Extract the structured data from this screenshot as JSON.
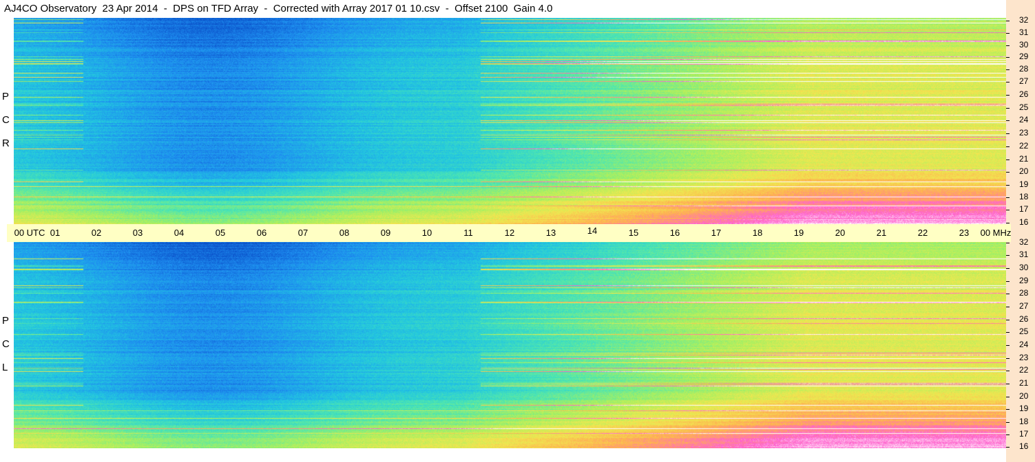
{
  "title": "AJ4CO Observatory  23 Apr 2014  -  DPS on TFD Array  -  Corrected with Array 2017 01 10.csv  -  Offset 2100  Gain 4.0",
  "panels": [
    {
      "id": "rcp",
      "letters": [
        "P",
        "C",
        "R"
      ]
    },
    {
      "id": "lcp",
      "letters": [
        "P",
        "C",
        "L"
      ]
    }
  ],
  "time_axis": {
    "labels": [
      "00  UTC",
      "01",
      "02",
      "03",
      "04",
      "05",
      "06",
      "07",
      "08",
      "09",
      "10",
      "11",
      "12",
      "13",
      "14",
      "15",
      "16",
      "17",
      "18",
      "19",
      "20",
      "21",
      "22",
      "23",
      "00 MHz"
    ]
  },
  "frequency_axis": {
    "unit": "MHz",
    "labels": [
      "32",
      "31",
      "30",
      "29",
      "28",
      "27",
      "26",
      "25",
      "24",
      "23",
      "22",
      "21",
      "20",
      "19",
      "18",
      "17",
      "16"
    ]
  },
  "colors": {
    "axis_bar": "#ffffc4",
    "right_strip": "#fde5cc",
    "colormap": [
      "#0a4fc8",
      "#1e8ef0",
      "#22c7e0",
      "#4ee6b0",
      "#a8f060",
      "#f0e850",
      "#ffb050",
      "#ff60d0",
      "#ffffff"
    ]
  }
}
